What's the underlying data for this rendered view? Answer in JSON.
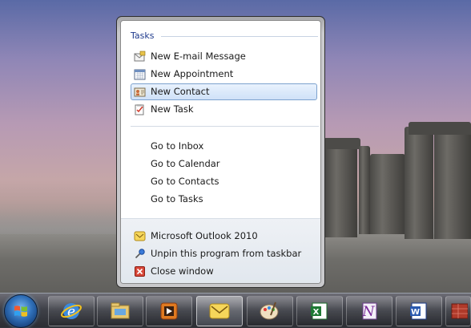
{
  "jump_list": {
    "tasks_header": "Tasks",
    "tasks": [
      {
        "label": "New E-mail Message",
        "icon": "new-email-icon"
      },
      {
        "label": "New Appointment",
        "icon": "calendar-icon"
      },
      {
        "label": "New Contact",
        "icon": "contact-card-icon",
        "selected": true
      },
      {
        "label": "New Task",
        "icon": "task-clipboard-icon"
      }
    ],
    "goto": [
      {
        "label": "Go to Inbox"
      },
      {
        "label": "Go to Calendar"
      },
      {
        "label": "Go to Contacts"
      },
      {
        "label": "Go to Tasks"
      }
    ],
    "footer": [
      {
        "label": "Microsoft Outlook 2010",
        "icon": "outlook-icon"
      },
      {
        "label": "Unpin this program from taskbar",
        "icon": "unpin-icon"
      },
      {
        "label": "Close window",
        "icon": "close-window-icon"
      }
    ]
  },
  "taskbar": {
    "start_icon": "windows-start-orb-icon",
    "apps": [
      {
        "name": "internet-explorer-icon"
      },
      {
        "name": "windows-explorer-icon"
      },
      {
        "name": "media-player-icon"
      },
      {
        "name": "outlook-icon",
        "active": true
      },
      {
        "name": "paint-icon"
      },
      {
        "name": "excel-icon"
      },
      {
        "name": "onenote-icon"
      },
      {
        "name": "word-icon"
      },
      {
        "name": "access-icon"
      }
    ]
  },
  "colors": {
    "accent": "#1e3a8c",
    "selection": "#cfe1f8",
    "selection_border": "#7da2ce"
  }
}
